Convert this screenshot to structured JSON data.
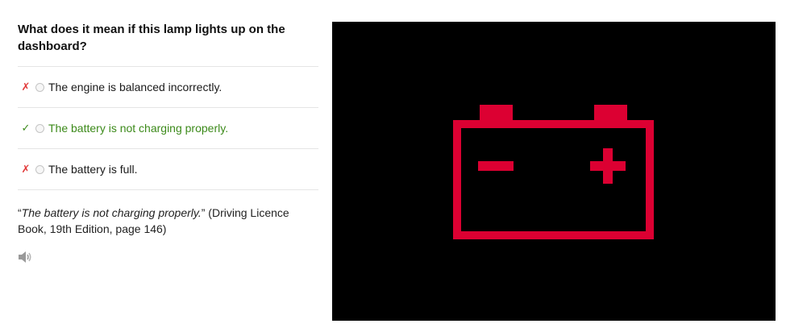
{
  "question": "What does it mean if this lamp lights up on the dashboard?",
  "answers": [
    {
      "mark": "✗",
      "text": "The engine is balanced incorrectly.",
      "correct": false
    },
    {
      "mark": "✓",
      "text": "The battery is not charging properly.",
      "correct": true
    },
    {
      "mark": "✗",
      "text": "The battery is full.",
      "correct": false
    }
  ],
  "explanation": {
    "open_quote": "“",
    "quote": "The battery is not charging properly.",
    "close_quote": "”",
    "source": " (Driving Licence Book, 19th Edition, page 146)"
  },
  "icons": {
    "audio": "speaker-icon",
    "warning_lamp": "battery-warning-icon"
  },
  "colors": {
    "lamp": "#dc0032",
    "panel_background": "#000000",
    "correct": "#3c8a1a",
    "wrong": "#e23b3b"
  }
}
